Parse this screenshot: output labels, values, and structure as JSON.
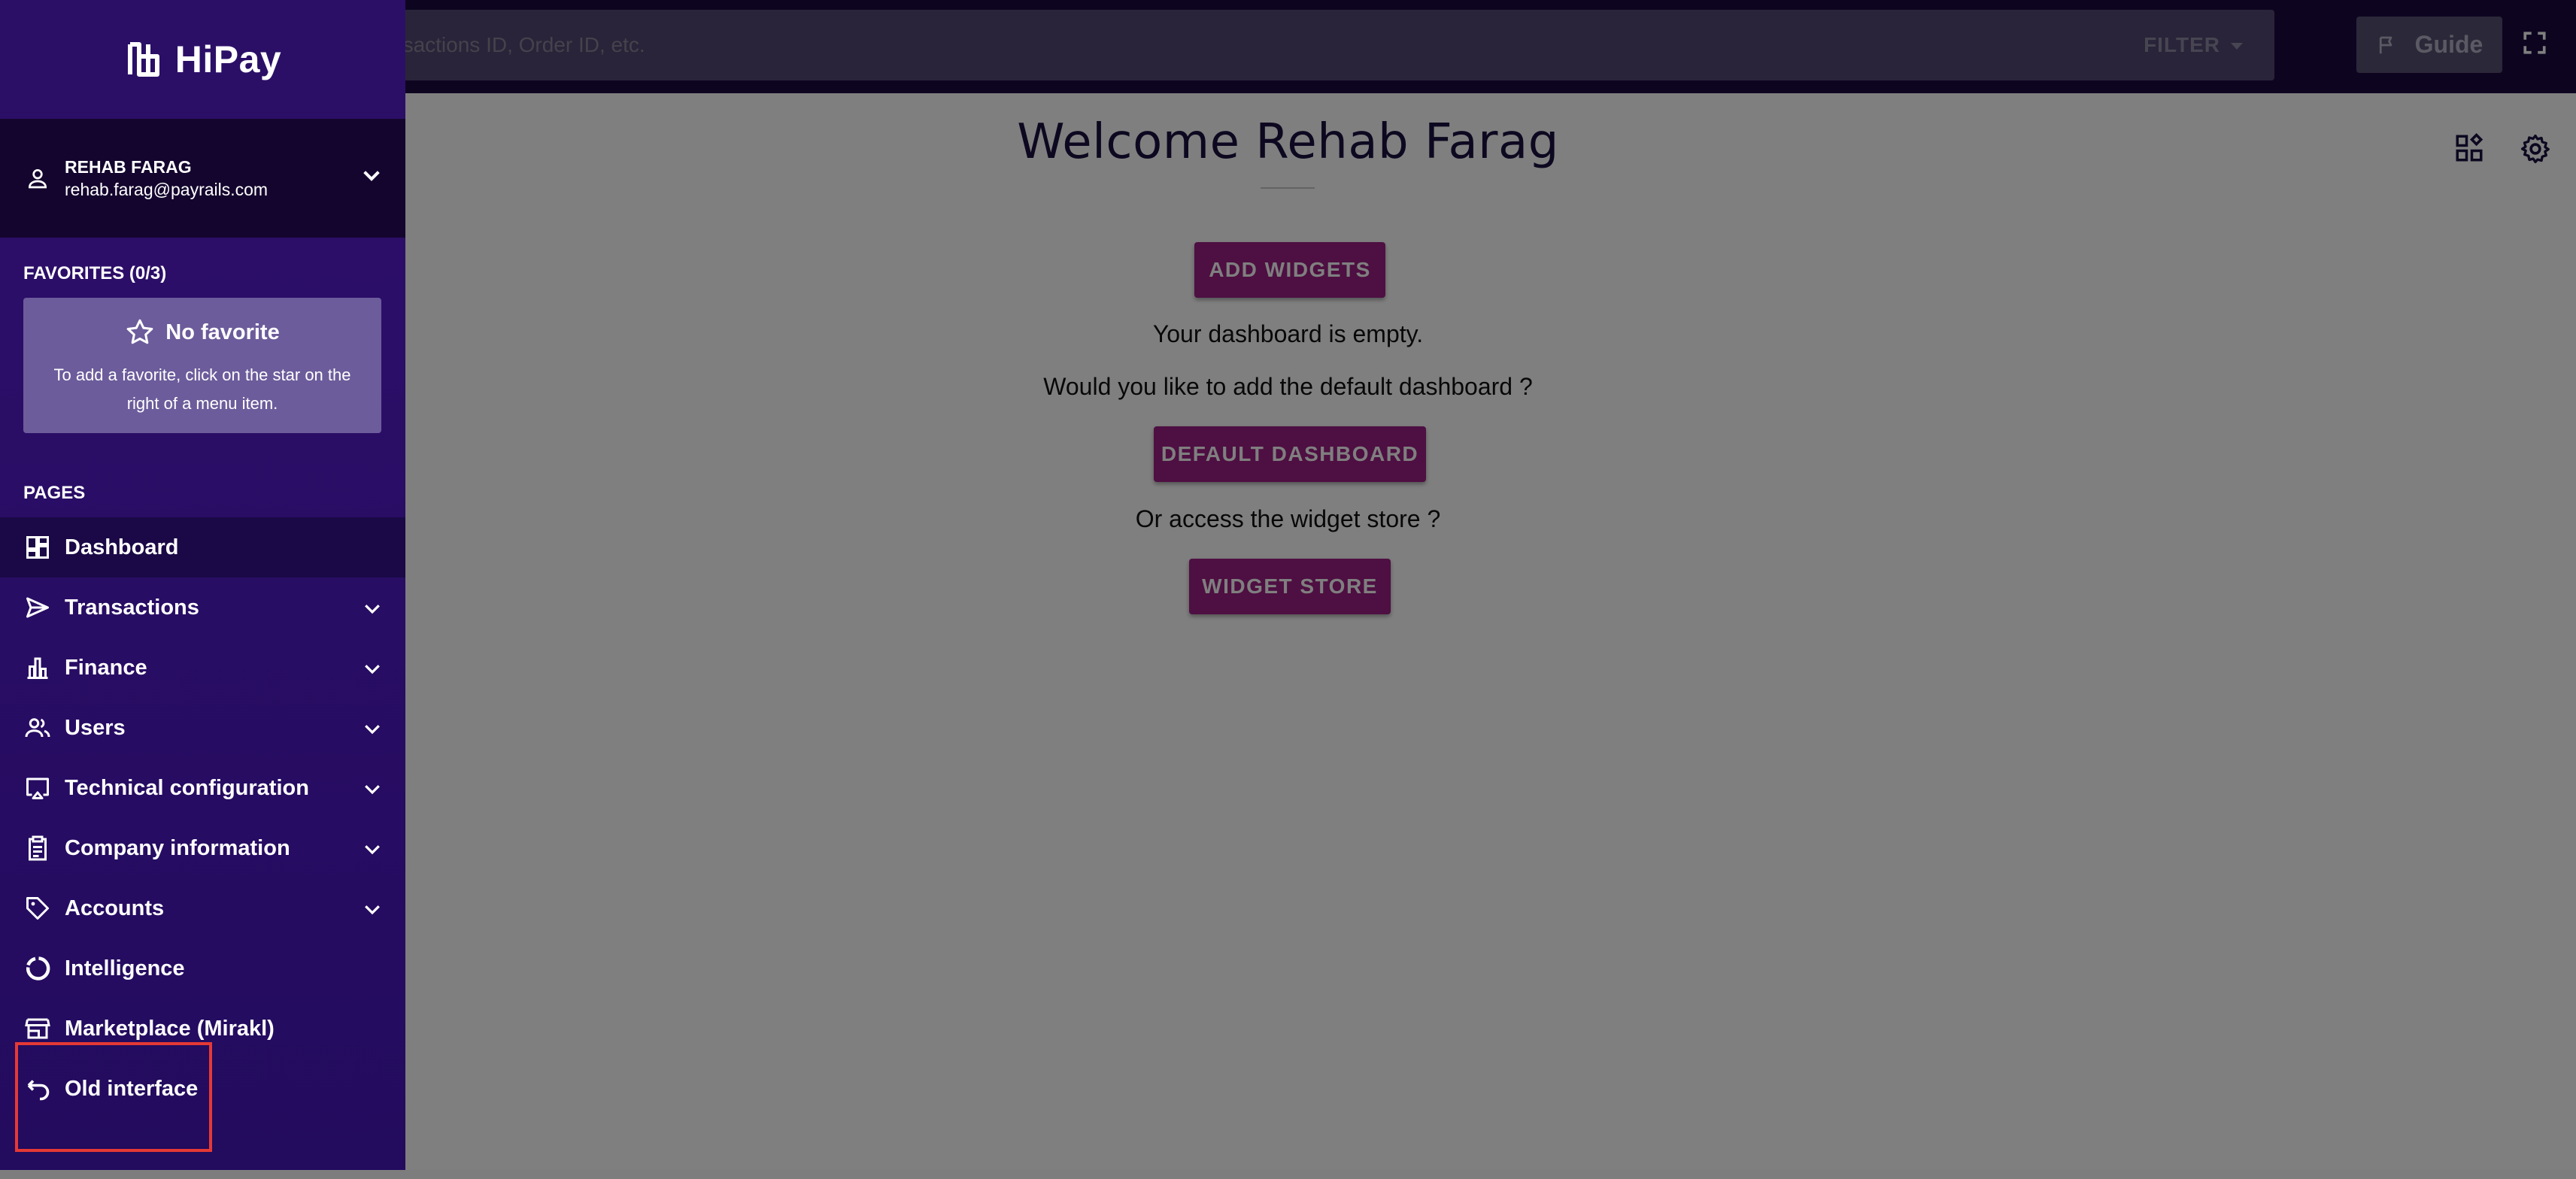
{
  "search": {
    "placeholder": "nsactions ID, Order ID, etc.",
    "filter_label": "FILTER"
  },
  "header": {
    "guide_label": "Guide"
  },
  "main": {
    "welcome_title": "Welcome Rehab Farag",
    "add_widgets_label": "ADD WIDGETS",
    "empty_text": "Your dashboard is empty.",
    "default_question": "Would you like to add the default dashboard ?",
    "default_dashboard_label": "DEFAULT DASHBOARD",
    "store_question": "Or access the widget store ?",
    "widget_store_label": "WIDGET STORE"
  },
  "sidebar": {
    "brand": "HiPay",
    "user": {
      "name": "REHAB FARAG",
      "email": "rehab.farag@payrails.com"
    },
    "favorites": {
      "title": "FAVORITES (0/3)",
      "empty_title": "No favorite",
      "empty_desc": "To add a favorite, click on the star on the right of a menu item."
    },
    "pages_title": "PAGES",
    "items": [
      {
        "label": "Dashboard",
        "icon": "dashboard-icon"
      },
      {
        "label": "Transactions",
        "icon": "send-icon"
      },
      {
        "label": "Finance",
        "icon": "bar-chart-icon"
      },
      {
        "label": "Users",
        "icon": "users-icon"
      },
      {
        "label": "Technical configuration",
        "icon": "monitor-icon"
      },
      {
        "label": "Company information",
        "icon": "clipboard-icon"
      },
      {
        "label": "Accounts",
        "icon": "tag-icon"
      },
      {
        "label": "Intelligence",
        "icon": "donut-icon"
      },
      {
        "label": "Marketplace (Mirakl)",
        "icon": "store-icon"
      },
      {
        "label": "Old interface",
        "icon": "undo-icon"
      }
    ]
  },
  "colors": {
    "sidebar_bg": "#2e0f6b",
    "topbar_bg": "#1a0a40",
    "primary_button": "#9c1e84",
    "highlight": "#e53935"
  }
}
